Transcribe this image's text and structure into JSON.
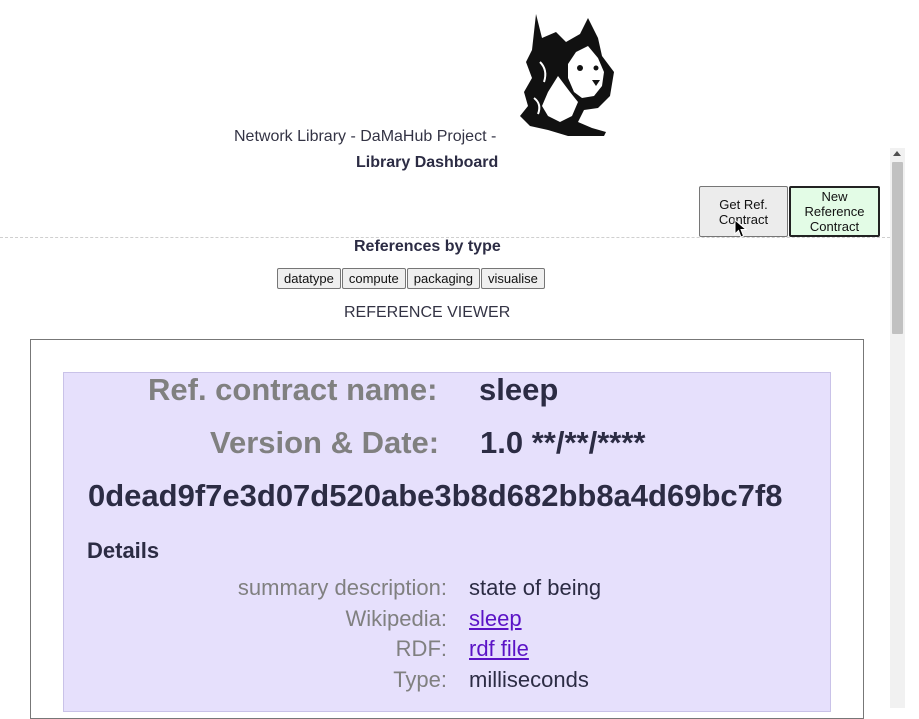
{
  "header": {
    "network_title": "Network Library - DaMaHub Project -",
    "dashboard_title": "Library Dashboard"
  },
  "actions": {
    "get_ref_contract": "Get Ref. Contract",
    "new_reference_contract": "New Reference Contract"
  },
  "references": {
    "title": "References by type",
    "types": [
      "datatype",
      "compute",
      "packaging",
      "visualise"
    ]
  },
  "viewer": {
    "label": "REFERENCE VIEWER",
    "contract_name_label": "Ref. contract name:",
    "contract_name": "sleep",
    "version_label": "Version & Date:",
    "version_value": "1.0 **/**/****",
    "hash": "0dead9f7e3d07d520abe3b8d682bb8a4d69bc7f8",
    "details_title": "Details",
    "details": {
      "summary_label": "summary description:",
      "summary_value": "state of being",
      "wikipedia_label": "Wikipedia:",
      "wikipedia_value": "sleep",
      "rdf_label": "RDF:",
      "rdf_value": "rdf file",
      "type_label": "Type:",
      "type_value": "milliseconds"
    }
  },
  "icons": {
    "logo": "cat-logo-icon",
    "cursor": "mouse-cursor-icon"
  },
  "colors": {
    "viewer_background": "#e6e0fc",
    "new_contract_button": "#e3fce6",
    "link": "#5b13c6",
    "label_gray": "#808080"
  }
}
